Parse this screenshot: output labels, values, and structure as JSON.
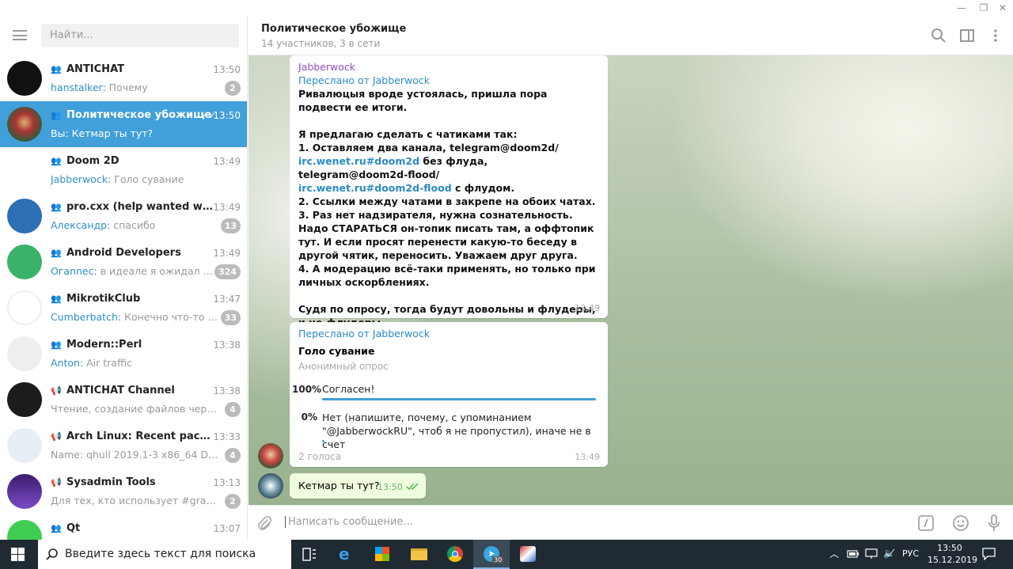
{
  "window": {
    "min": "—",
    "restore": "❐",
    "close": "✕"
  },
  "search": {
    "placeholder": "Найти..."
  },
  "chats": [
    {
      "name": "ANTICHAT",
      "time": "13:50",
      "sender": "hanstalker:",
      "preview": " Почему",
      "badge": "2",
      "type": "group"
    },
    {
      "name": "Политическое убожище",
      "time": "13:50",
      "sender": "",
      "preview": "Вы: Кетмар ты тут?",
      "badge": "",
      "type": "group",
      "active": true
    },
    {
      "name": "Doom 2D",
      "time": "13:49",
      "sender": "Jabberwock:",
      "preview": " Голо сувание",
      "badge": "",
      "type": "group"
    },
    {
      "name": "pro.cxx (help wanted with nu...",
      "time": "13:49",
      "sender": "Александр:",
      "preview": " спасибо",
      "badge": "13",
      "type": "group"
    },
    {
      "name": "Android Developers",
      "time": "13:49",
      "sender": "Огannес:",
      "preview": " в идеале я ожидал ответ ...",
      "badge": "324",
      "type": "group"
    },
    {
      "name": "MikrotikClub",
      "time": "13:47",
      "sender": "Cumberbatch:",
      "preview": " Конечно что-то мож...",
      "badge": "33",
      "type": "group"
    },
    {
      "name": "Modern::Perl",
      "time": "13:38",
      "sender": "Anton:",
      "preview": " Air traffic",
      "badge": "",
      "type": "group"
    },
    {
      "name": "ANTICHAT Channel",
      "time": "13:38",
      "sender": "",
      "preview": "Чтение, создание файлов через уяз...",
      "badge": "4",
      "type": "channel"
    },
    {
      "name": "Arch Linux: Recent package u...",
      "time": "13:33",
      "sender": "",
      "preview": "Name: qhull 2019.1-3 x86_64 Descripti...",
      "badge": "4",
      "type": "channel"
    },
    {
      "name": "Sysadmin Tools",
      "time": "13:13",
      "sender": "",
      "preview": "Для тех, кто использует #graphite ст...",
      "badge": "2",
      "type": "channel"
    },
    {
      "name": "Qt",
      "time": "13:07",
      "sender": "",
      "preview": "",
      "badge": "",
      "type": "group"
    }
  ],
  "header": {
    "title": "Политическое убожище",
    "subtitle": "14 участников, 3 в сети"
  },
  "msg1": {
    "sender": "Jabberwock",
    "forwarded": "Переслано от Jabberwock",
    "line1": "Ривалюцыя вроде устоялась, пришла пора подвести ее итоги.",
    "line2": "Я предлагаю сделать с чатиками так:",
    "line3a": "1. Оставляем два канала, telegram@doom2d/",
    "link1": "irc.wenet.ru#doom2d",
    "line3b": " без флуда, telegram@doom2d-flood/",
    "link2": "irc.wenet.ru#doom2d-flood",
    "line3c": " с флудом.",
    "line4": "2. Ссылки между чатами в закрепе на обоих чатах.",
    "line5": "3. Раз нет надзирателя, нужна сознательность. Надо СТАРАТЬСЯ он-топик писать там, а оффтопик тут. И если просят перенести какую-то беседу в другой чятик, переносить. Уважаем друг друга.",
    "line6": "4. А модерацию всё-таки применять, но только при личных оскорблениях.",
    "line7": "Судя по опросу, тогда будут довольны и флудеры, и не-флудеры.",
    "time": "13:49"
  },
  "msg2": {
    "forwarded": "Переслано от Jabberwock",
    "question": "Голо сувание",
    "poll_type": "Анонимный опрос",
    "options": [
      {
        "pct": "100%",
        "text": "Согласен!",
        "fraction": 1.0
      },
      {
        "pct": "0%",
        "text": "Нет (напишите, почему, с упоминанием \"@JabberwockRU\", чтоб я не пропустил), иначе не в счет",
        "fraction": 0.0
      }
    ],
    "votes": "2 голоса",
    "time": "13:49"
  },
  "msg3": {
    "text": "Кетмар ты тут?",
    "time": "13:50"
  },
  "composer": {
    "placeholder": "Написать сообщение..."
  },
  "taskbar": {
    "search_placeholder": "Введите здесь текст для поиска",
    "lang": "РУС",
    "time": "13:50",
    "date": "15.12.2019",
    "telegram_badge": "30"
  },
  "colors": {
    "accent": "#419fd9",
    "sender": "#8e4ec6",
    "link": "#2a8bc5"
  }
}
